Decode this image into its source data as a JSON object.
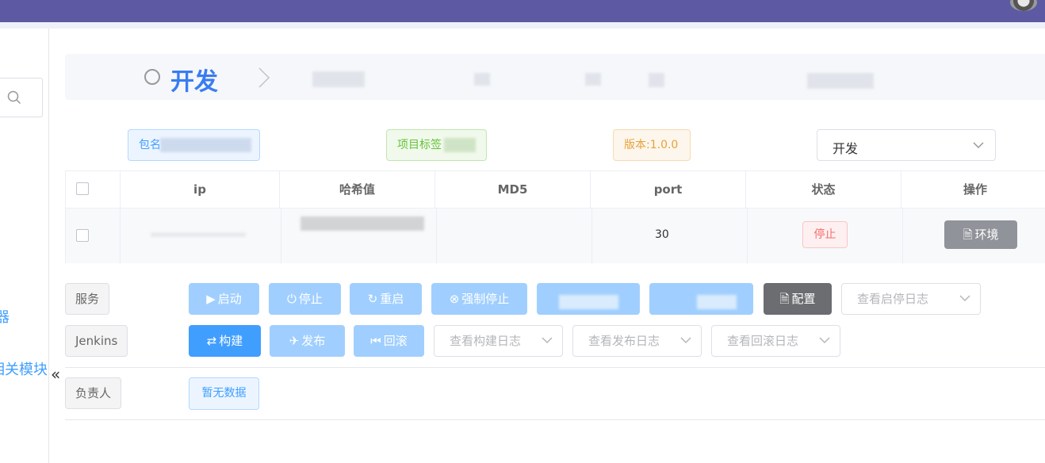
{
  "sidebar": {
    "item_1": "器",
    "item_2": "相关模块",
    "collapse_glyph": "«"
  },
  "breadcrumb": {
    "title": "开发",
    "separator": "〉"
  },
  "tags": {
    "package_label": "包名",
    "project_label": "项目标签",
    "version_label": "版本:1.0.0"
  },
  "env_select": {
    "value": "开发"
  },
  "table": {
    "headers": [
      "ip",
      "哈希值",
      "MD5",
      "port",
      "状态",
      "操作"
    ],
    "row": {
      "port": "30",
      "status": "停止",
      "action": "环境"
    }
  },
  "service": {
    "label": "服务",
    "start": "启动",
    "stop": "停止",
    "restart": "重启",
    "force_stop": "强制停止",
    "config": "配置",
    "view_start_stop_log": "查看启停日志"
  },
  "jenkins": {
    "label": "Jenkins",
    "build": "构建",
    "publish": "发布",
    "rollback": "回滚",
    "view_build_log": "查看构建日志",
    "view_publish_log": "查看发布日志",
    "view_rollback_log": "查看回滚日志"
  },
  "owner": {
    "label": "负责人",
    "empty": "暂无数据"
  },
  "colors": {
    "topbar": "#5d5aa3",
    "primary": "#409eff",
    "primary_light": "#a0cfff",
    "danger": "#f56c6c",
    "info": "#909399"
  }
}
